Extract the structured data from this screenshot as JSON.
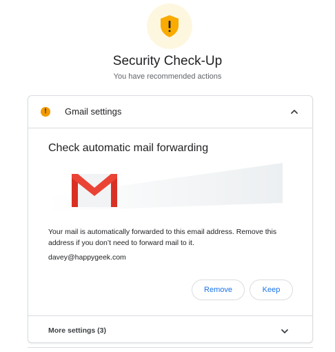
{
  "header": {
    "title": "Security Check-Up",
    "subtitle": "You have recommended actions",
    "shield_icon": "shield-warning-icon",
    "shield_color": "#f9ab00",
    "shield_bg": "#fef7e0"
  },
  "card": {
    "header_label": "Gmail settings",
    "warning_icon": "warning-dot-icon",
    "collapse_icon": "chevron-up-icon",
    "section_title": "Check automatic mail forwarding",
    "description": "Your mail is automatically forwarded to this email address. Remove this address if you don’t need to forward mail to it.",
    "email": "davey@happygeek.com",
    "buttons": {
      "remove_label": "Remove",
      "keep_label": "Keep"
    },
    "more_settings_label": "More settings (3)",
    "expand_icon": "chevron-down-icon"
  },
  "colors": {
    "accent": "#1a73e8",
    "warning": "#f29900",
    "gmail_red": "#ea4335"
  }
}
